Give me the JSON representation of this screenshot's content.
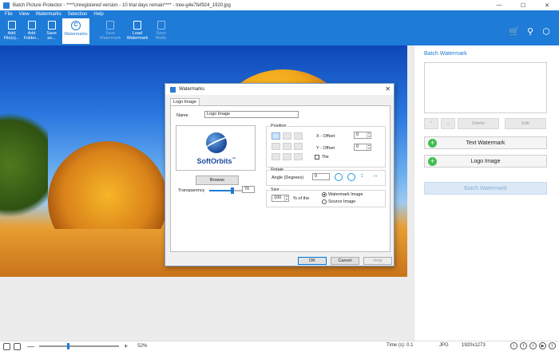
{
  "window": {
    "title": "Batch Picture Protector - ****Unregistered version - 10 trial days remain**** - tree-g4e7fef924_1920.jpg"
  },
  "menu": [
    "File",
    "View",
    "Watermarks",
    "Selection",
    "Help"
  ],
  "toolbar": {
    "add_files": "Add File(s)...",
    "add_folder": "Add Folder...",
    "save_as": "Save as...",
    "watermarks": "Watermarks",
    "save_watermark": "Save Watermark",
    "load_watermark": "Load Watermark",
    "save_mode": "Save Mode"
  },
  "panel": {
    "title": "Batch Watermark",
    "delete": "Delete",
    "edit": "Edit",
    "text_watermark": "Text Watermark",
    "logo_image": "Logo Image",
    "batch_watermark": "Batch Watermark"
  },
  "dialog": {
    "title": "Watermarks",
    "tab": "Logo Image",
    "name_label": "Name",
    "name_value": "Logo Image",
    "logo_text": "SoftOrbits",
    "logo_tm": "™",
    "browse": "Browse",
    "transparency_label": "Transparency",
    "transparency_value": "70",
    "transparency_fraction": 0.7,
    "position_label": "Position",
    "x_offset_label": "X - Offset",
    "x_offset_value": "0",
    "y_offset_label": "Y - Offset",
    "y_offset_value": "0",
    "tile_label": "Tile",
    "rotate_label": "Rotate",
    "angle_label": "Angle (Degrees)",
    "angle_value": "0",
    "size_label": "Size",
    "size_value": "100",
    "size_suffix": "% of the",
    "radio_watermark": "Watermark Image",
    "radio_source": "Source Image",
    "ok": "OK",
    "cancel": "Cancel",
    "help": "Help"
  },
  "status": {
    "zoom": "52%",
    "zoom_fraction": 0.36,
    "time": "Time (s): 0.1",
    "format": "JPG",
    "dimensions": "1920x1273"
  }
}
